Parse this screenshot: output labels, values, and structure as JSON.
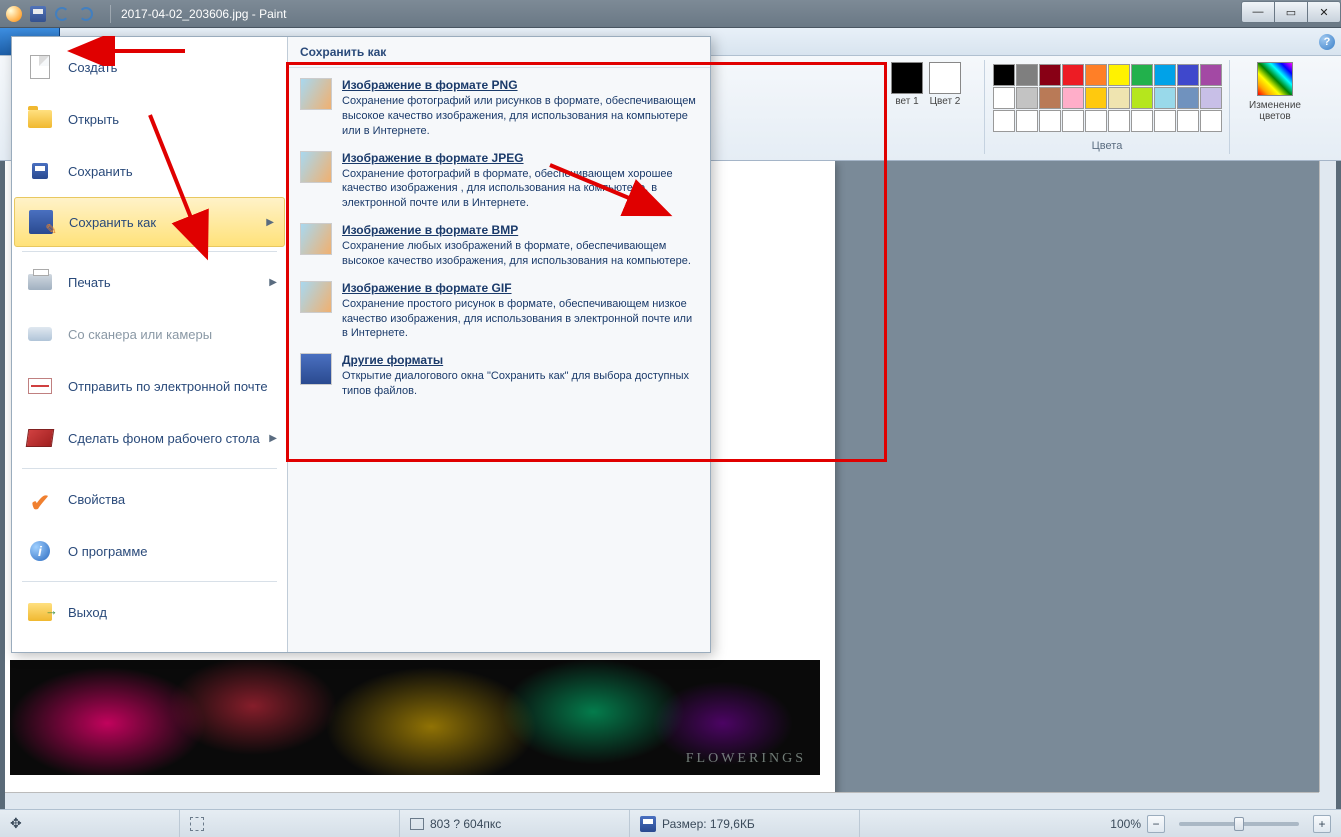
{
  "title": "2017-04-02_203606.jpg - Paint",
  "ribbon": {
    "color1_label": "вет\n1",
    "color2_label": "Цвет\n2",
    "colors_group": "Цвета",
    "edit_colors": "Изменение\nцветов",
    "palette": [
      "#000000",
      "#7f7f7f",
      "#880015",
      "#ed1c24",
      "#ff7f27",
      "#fff200",
      "#22b14c",
      "#00a2e8",
      "#3f48cc",
      "#a349a4",
      "#ffffff",
      "#c3c3c3",
      "#b97a57",
      "#ffaec9",
      "#ffc90e",
      "#efe4b0",
      "#b5e61d",
      "#99d9ea",
      "#7092be",
      "#c8bfe7",
      "#ffffff",
      "#ffffff",
      "#ffffff",
      "#ffffff",
      "#ffffff",
      "#ffffff",
      "#ffffff",
      "#ffffff",
      "#ffffff",
      "#ffffff"
    ],
    "current_color1": "#000000",
    "current_color2": "#ffffff"
  },
  "file_menu": [
    {
      "label": "Создать",
      "icon": "doc"
    },
    {
      "label": "Открыть",
      "icon": "folder"
    },
    {
      "label": "Сохранить",
      "icon": "save"
    },
    {
      "label": "Сохранить как",
      "icon": "saveas",
      "arrow": true,
      "hover": true
    },
    {
      "label": "Печать",
      "icon": "printer",
      "arrow": true
    },
    {
      "label": "Со сканера или камеры",
      "icon": "scanner",
      "disabled": true
    },
    {
      "label": "Отправить по электронной почте",
      "icon": "mail"
    },
    {
      "label": "Сделать фоном рабочего стола",
      "icon": "desktop",
      "arrow": true
    },
    {
      "label": "Свойства",
      "icon": "check"
    },
    {
      "label": "О программе",
      "icon": "info"
    },
    {
      "label": "Выход",
      "icon": "exit"
    }
  ],
  "saveas_title": "Сохранить как",
  "saveas_options": [
    {
      "title": "Изображение в формате PNG",
      "desc": "Сохранение фотографий или рисунков в формате, обеспечивающем высокое качество изображения, для использования на компьютере или в Интернете."
    },
    {
      "title": "Изображение в формате JPEG",
      "desc": "Сохранение фотографий в формате, обеспечивающем хорошее качество изображения , для использования на компьютере, в электронной почте или в Интернете."
    },
    {
      "title": "Изображение в формате BMP",
      "desc": "Сохранение любых изображений в формате, обеспечивающем высокое качество изображения, для использования на компьютере."
    },
    {
      "title": "Изображение в формате GIF",
      "desc": "Сохранение простого рисунок в формате, обеспечивающем низкое качество изображения, для использования в электронной почте или в Интернете."
    },
    {
      "title": "Другие форматы",
      "desc": "Открытие диалогового окна \"Сохранить как\" для выбора доступных типов файлов."
    }
  ],
  "status": {
    "dimensions": "803 ? 604пкс",
    "size_label": "Размер: 179,6КБ",
    "zoom": "100%",
    "watermark": "FLOWERINGS"
  }
}
